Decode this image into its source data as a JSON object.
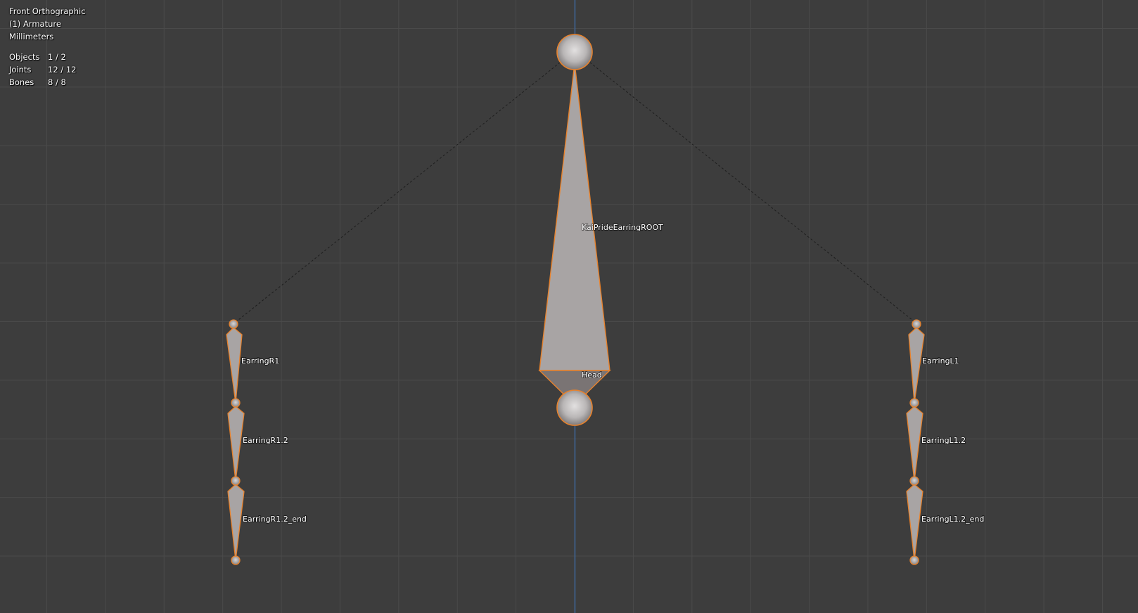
{
  "viewport": {
    "view_name": "Front Orthographic",
    "object_name": "(1) Armature",
    "units": "Millimeters"
  },
  "stats": [
    {
      "label": "Objects",
      "value": "1 / 2"
    },
    {
      "label": "Joints",
      "value": "12 / 12"
    },
    {
      "label": "Bones",
      "value": "8 / 8"
    }
  ],
  "bones": {
    "root": "KaiPrideEarringROOT",
    "head": "Head",
    "r1": "EarringR1",
    "r12": "EarringR1.2",
    "r12end": "EarringR1.2_end",
    "l1": "EarringL1",
    "l12": "EarringL1.2",
    "l12end": "EarringL1.2_end"
  },
  "colors": {
    "background": "#3d3d3d",
    "grid": "#4a4a4a",
    "axis_z": "#3a6fb5",
    "bone_fill": "#a8a4a4",
    "selection_outline": "#e8822c"
  }
}
